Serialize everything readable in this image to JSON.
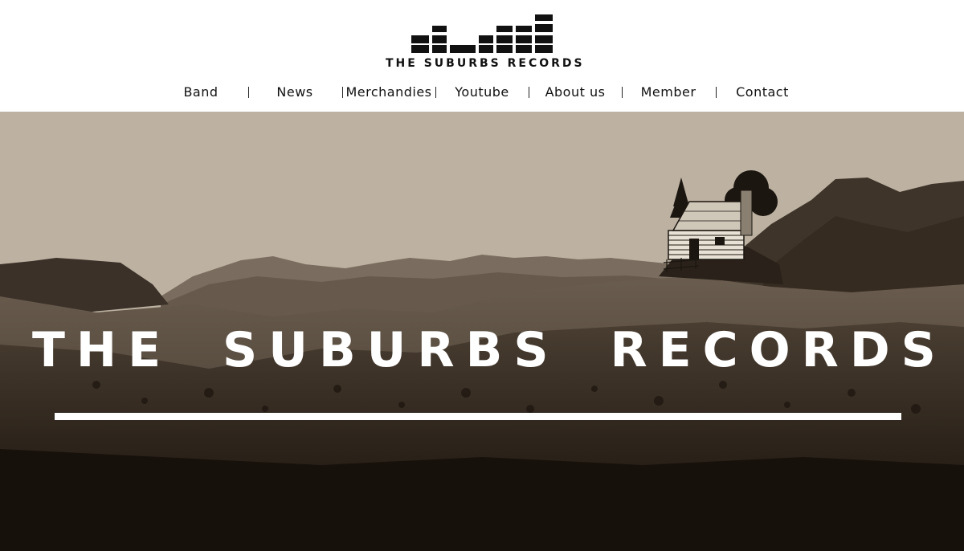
{
  "logo": {
    "text": "THE SUBURBS RECORDS",
    "icon": "equalizer-bars-icon"
  },
  "nav": {
    "items": [
      {
        "label": "Band"
      },
      {
        "label": "News"
      },
      {
        "label": "Merchandies"
      },
      {
        "label": "Youtube"
      },
      {
        "label": "About us"
      },
      {
        "label": "Member"
      },
      {
        "label": "Contact"
      }
    ]
  },
  "hero": {
    "title": "THE SUBURBS RECORDS",
    "image": "sepia-mountain-landscape-with-cabin",
    "colors": {
      "sky": "#bdb2a2",
      "far_hills": "#6b5f52",
      "mid_hills": "#3e342a",
      "foreground": "#1f1810",
      "text": "#ffffff"
    }
  }
}
